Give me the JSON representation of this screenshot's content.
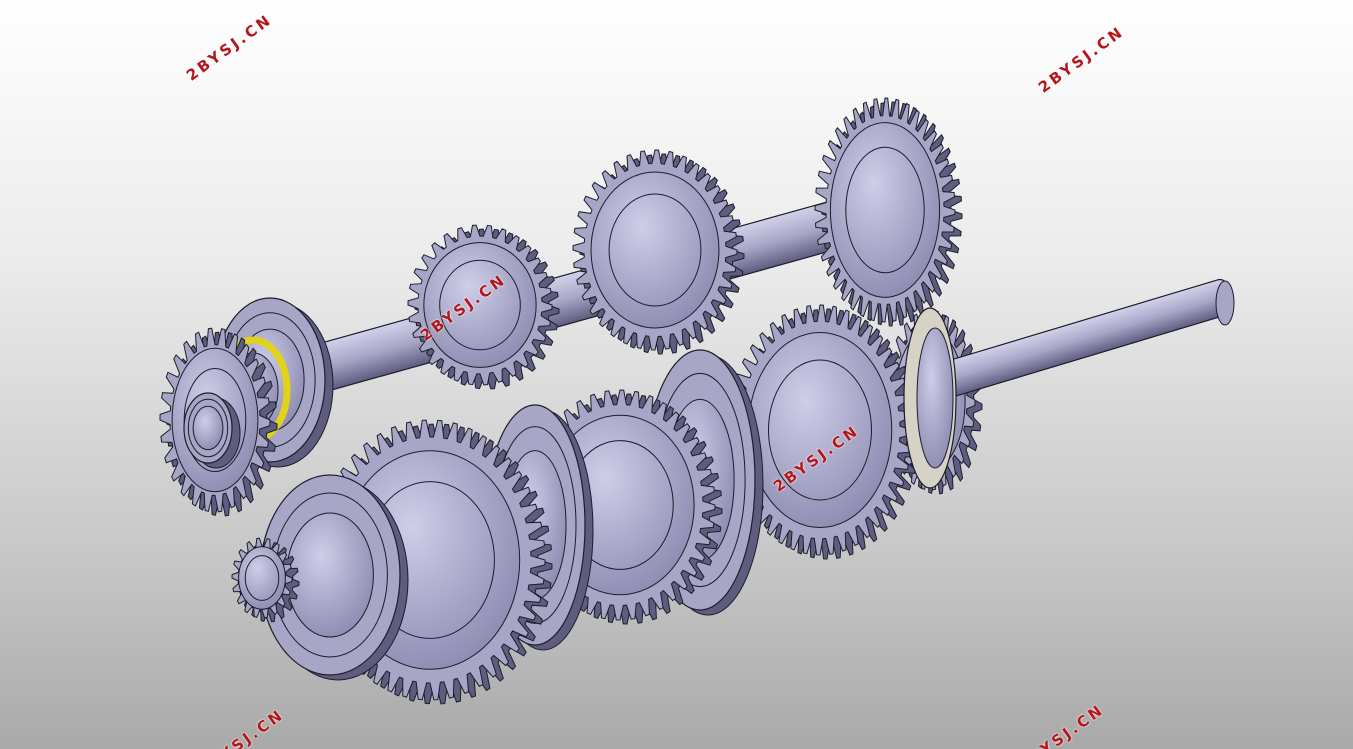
{
  "watermark": {
    "text": "2BYSJ.CN",
    "color": "#b3161b"
  },
  "model": {
    "part_color": "#a7a6c7",
    "part_shadow_color": "#5e5d80",
    "edge_color": "#1d1d2a",
    "highlight_color": "#e1d21a"
  },
  "background": {
    "top": "#ffffff",
    "bottom": "#a9a9a9"
  }
}
